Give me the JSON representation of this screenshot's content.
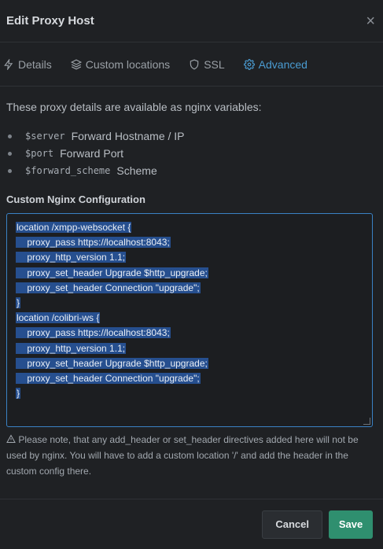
{
  "header": {
    "title": "Edit Proxy Host",
    "close_glyph": "×"
  },
  "tabs": [
    {
      "label": "Details",
      "icon": "bolt-icon",
      "active": false
    },
    {
      "label": "Custom locations",
      "icon": "layers-icon",
      "active": false
    },
    {
      "label": "SSL",
      "icon": "shield-icon",
      "active": false
    },
    {
      "label": "Advanced",
      "icon": "gear-icon",
      "active": true
    }
  ],
  "intro": "These proxy details are available as nginx variables:",
  "variables": [
    {
      "code": "$server",
      "desc": "Forward Hostname / IP"
    },
    {
      "code": "$port",
      "desc": "Forward Port"
    },
    {
      "code": "$forward_scheme",
      "desc": "Scheme"
    }
  ],
  "config": {
    "label": "Custom Nginx Configuration",
    "lines": [
      "location /xmpp-websocket {",
      "    proxy_pass https://localhost:8043;",
      "    proxy_http_version 1.1;",
      "    proxy_set_header Upgrade $http_upgrade;",
      "    proxy_set_header Connection \"upgrade\";",
      "}",
      "location /colibri-ws {",
      "    proxy_pass https://localhost:8043;",
      "    proxy_http_version 1.1;",
      "    proxy_set_header Upgrade $http_upgrade;",
      "    proxy_set_header Connection \"upgrade\";",
      "}"
    ]
  },
  "note": "Please note, that any add_header or set_header directives added here will not be used by nginx. You will have to add a custom location '/' and add the header in the custom config there.",
  "buttons": {
    "cancel": "Cancel",
    "save": "Save"
  },
  "colors": {
    "accent": "#4a9bd1",
    "save": "#2f8f6f",
    "selection": "#264f8f"
  }
}
